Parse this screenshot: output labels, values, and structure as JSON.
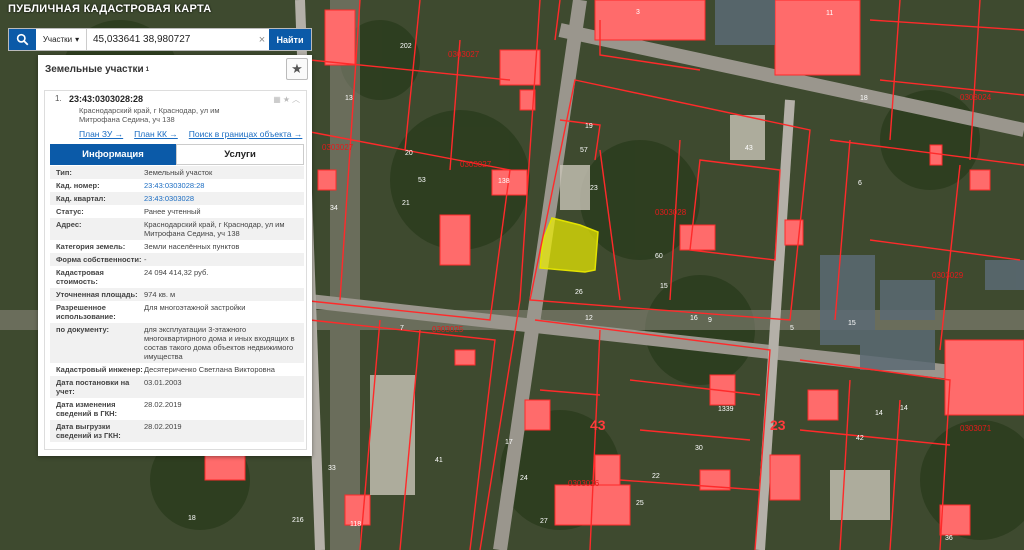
{
  "app": {
    "title": "ПУБЛИЧНАЯ КАДАСТРОВАЯ КАРТА"
  },
  "search": {
    "scope": "Участки",
    "query": "45,033641 38,980727",
    "button": "Найти"
  },
  "panel": {
    "title": "Земельные участки",
    "count_sup": "1",
    "item_number": "1.",
    "cadastral_number": "23:43:0303028:28",
    "address": "Краснодарский край, г Краснодар, ул им Митрофана Седина, уч 138",
    "links": [
      "План ЗУ →",
      "План КК →",
      "Поиск в границах объекта →"
    ],
    "tabs": [
      "Информация",
      "Услуги"
    ],
    "fields": [
      {
        "label": "Тип:",
        "value": "Земельный участок"
      },
      {
        "label": "Кад. номер:",
        "value": "23:43:0303028:28"
      },
      {
        "label": "Кад. квартал:",
        "value": "23:43:0303028"
      },
      {
        "label": "Статус:",
        "value": "Ранее учтенный"
      },
      {
        "label": "Адрес:",
        "value": "Краснодарский край, г Краснодар, ул им Митрофана Седина, уч 138"
      },
      {
        "label": "Категория земель:",
        "value": "Земли населённых пунктов"
      },
      {
        "label": "Форма собственности:",
        "value": "-"
      },
      {
        "label": "Кадастровая стоимость:",
        "value": "24 094 414,32 руб."
      },
      {
        "label": "Уточненная площадь:",
        "value": "974 кв. м"
      },
      {
        "label": "Разрешенное использование:",
        "value": "Для многоэтажной застройки"
      },
      {
        "label": "по документу:",
        "value": "для эксплуатации 3-этажного многоквартирного дома и иных входящих в состав такого дома объектов недвижимого имущества"
      },
      {
        "label": "Кадастровый инженер:",
        "value": "Десятериченко Светлана Викторовна"
      },
      {
        "label": "Дата постановки на учет:",
        "value": "03.01.2003"
      },
      {
        "label": "Дата изменения сведений в ГКН:",
        "value": "28.02.2019"
      },
      {
        "label": "Дата выгрузки сведений из ГКН:",
        "value": "28.02.2019"
      }
    ]
  },
  "map": {
    "quarter_labels": [
      "0303027",
      "0303028",
      "0303029",
      "0303025",
      "0303026",
      "0303024",
      "0303071",
      "0303027",
      "0303027"
    ],
    "parcel_labels": [
      "3",
      "11",
      "202",
      "13",
      "20",
      "53",
      "138",
      "21",
      "26",
      "15",
      "19",
      "57",
      "7",
      "34",
      "23",
      "43",
      "16",
      "15",
      "14",
      "42",
      "41",
      "17",
      "1339",
      "14",
      "5",
      "12",
      "30",
      "36",
      "24",
      "18",
      "25",
      "22",
      "216",
      "118",
      "33",
      "60",
      "9",
      "6",
      "27",
      "18"
    ],
    "district_labels": [
      "43",
      "23"
    ],
    "colors": {
      "boundary": "#ff2a2a",
      "building": "#ff6b6b",
      "selected": "#f0f000"
    }
  },
  "icons": {
    "search": "search-icon",
    "star": "star-icon",
    "clear": "clear-icon",
    "dropdown": "chevron-down-icon"
  }
}
